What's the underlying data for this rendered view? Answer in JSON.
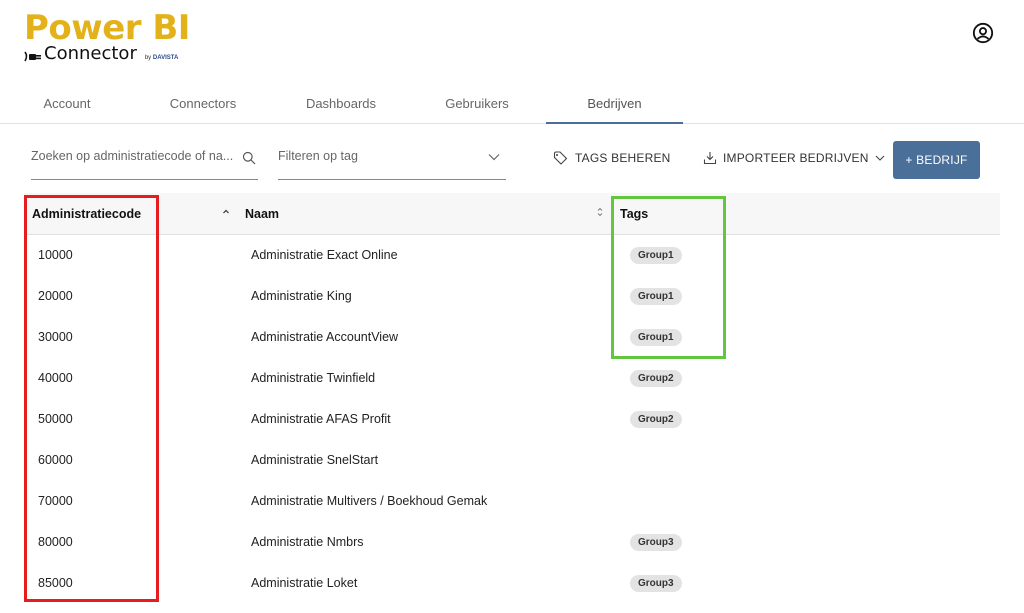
{
  "logo": {
    "title": "Power BI",
    "subtitle": "Connector",
    "by": "by",
    "brand": "DAVISTA"
  },
  "tabs": [
    {
      "label": "Account",
      "active": false
    },
    {
      "label": "Connectors",
      "active": false
    },
    {
      "label": "Dashboards",
      "active": false
    },
    {
      "label": "Gebruikers",
      "active": false
    },
    {
      "label": "Bedrijven",
      "active": true
    }
  ],
  "toolbar": {
    "search_placeholder": "Zoeken op administratiecode of na...",
    "filter_placeholder": "Filteren op tag",
    "manage_tags_label": "TAGS BEHEREN",
    "import_label": "IMPORTEER BEDRIJVEN",
    "add_label": "+ BEDRIJF"
  },
  "table": {
    "headers": {
      "code": "Administratiecode",
      "name": "Naam",
      "tags": "Tags"
    },
    "rows": [
      {
        "code": "10000",
        "name": "Administratie Exact Online",
        "tag": "Group1"
      },
      {
        "code": "20000",
        "name": "Administratie King",
        "tag": "Group1"
      },
      {
        "code": "30000",
        "name": "Administratie AccountView",
        "tag": "Group1"
      },
      {
        "code": "40000",
        "name": "Administratie Twinfield",
        "tag": "Group2"
      },
      {
        "code": "50000",
        "name": "Administratie AFAS Profit",
        "tag": "Group2"
      },
      {
        "code": "60000",
        "name": "Administratie SnelStart",
        "tag": ""
      },
      {
        "code": "70000",
        "name": "Administratie Multivers / Boekhoud Gemak",
        "tag": ""
      },
      {
        "code": "80000",
        "name": "Administratie Nmbrs",
        "tag": "Group3"
      },
      {
        "code": "85000",
        "name": "Administratie Loket",
        "tag": "Group3"
      }
    ]
  },
  "colors": {
    "accent": "#4a6f99",
    "logo_yellow": "#e3b21b",
    "highlight_red": "#e51d1d",
    "highlight_green": "#63c640"
  },
  "icons": {
    "user": "user-circle-icon",
    "search": "search-icon",
    "tag": "tag-icon",
    "import": "import-icon",
    "chevron": "chevron-down-icon"
  }
}
